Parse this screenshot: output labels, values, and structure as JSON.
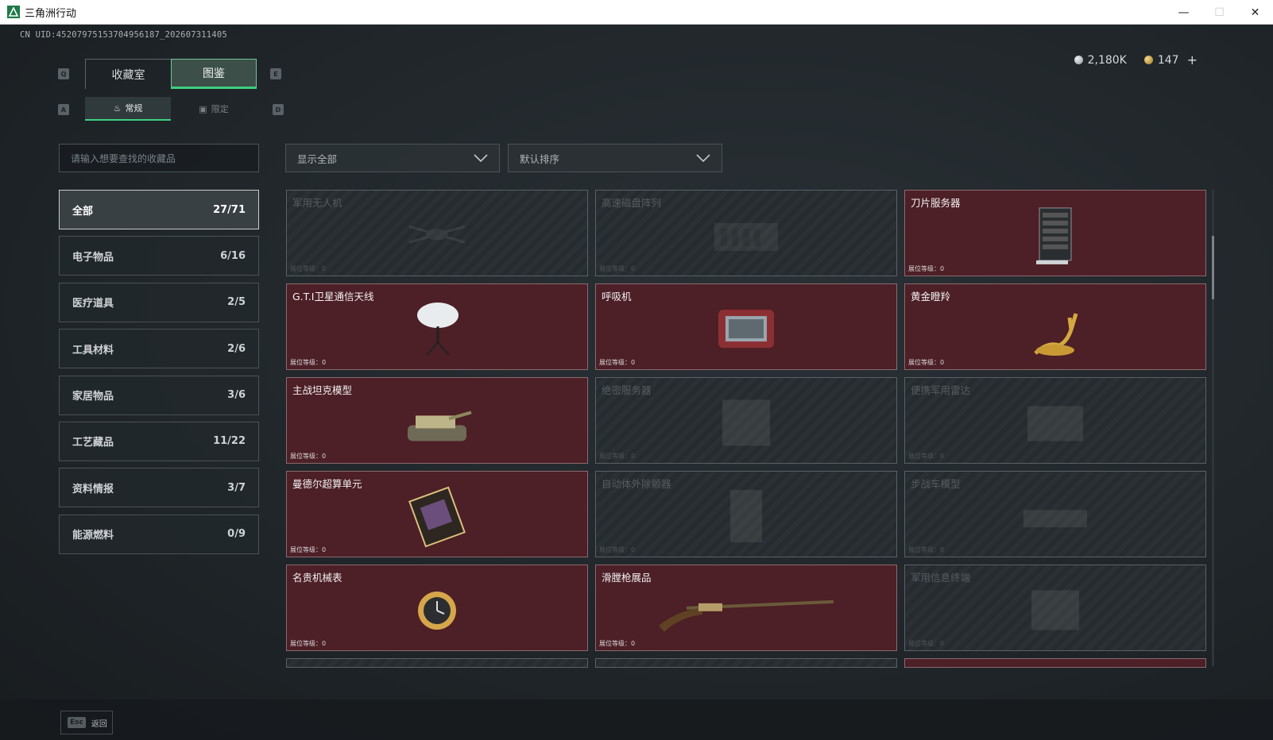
{
  "window": {
    "title": "三角洲行动",
    "minimize": "—",
    "maximize": "☐",
    "close": "✕"
  },
  "uid": "CN UID:4520797515370495​6187_202607311405",
  "currency": {
    "silver": "2,180K",
    "gold": "147",
    "plus": "+"
  },
  "keys": {
    "q": "Q",
    "e": "E",
    "a": "A",
    "d": "D"
  },
  "tabs_top": [
    {
      "label": "收藏室"
    },
    {
      "label": "图鉴"
    }
  ],
  "tabs_sub": [
    {
      "label": "常规",
      "icon": "flame-icon"
    },
    {
      "label": "限定",
      "icon": "image-icon"
    }
  ],
  "search": {
    "placeholder": "请输入想要查找的收藏品"
  },
  "filter": {
    "label": "显示全部"
  },
  "sort": {
    "label": "默认排序"
  },
  "categories": [
    {
      "name": "全部",
      "count": "27/71"
    },
    {
      "name": "电子物品",
      "count": "6/16"
    },
    {
      "name": "医疗道具",
      "count": "2/5"
    },
    {
      "name": "工具材料",
      "count": "2/6"
    },
    {
      "name": "家居物品",
      "count": "3/6"
    },
    {
      "name": "工艺藏品",
      "count": "11/22"
    },
    {
      "name": "资料情报",
      "count": "3/7"
    },
    {
      "name": "能源燃料",
      "count": "0/9"
    }
  ],
  "level_label": "展位等级：",
  "items": [
    {
      "name": "军用无人机",
      "level": "0",
      "owned": false,
      "icon": "drone-icon"
    },
    {
      "name": "高速磁盘阵列",
      "level": "0",
      "owned": false,
      "icon": "disk-array-icon"
    },
    {
      "name": "刀片服务器",
      "level": "0",
      "owned": true,
      "icon": "blade-server-icon"
    },
    {
      "name": "G.T.I卫星通信天线",
      "level": "0",
      "owned": true,
      "icon": "satellite-dish-icon"
    },
    {
      "name": "呼吸机",
      "level": "0",
      "owned": true,
      "icon": "ventilator-icon"
    },
    {
      "name": "黄金瞪羚",
      "level": "0",
      "owned": true,
      "icon": "gold-gazelle-icon"
    },
    {
      "name": "主战坦克模型",
      "level": "0",
      "owned": true,
      "icon": "tank-model-icon"
    },
    {
      "name": "绝密服务器",
      "level": "0",
      "owned": false,
      "icon": "server-icon"
    },
    {
      "name": "便携军用雷达",
      "level": "0",
      "owned": false,
      "icon": "radar-icon"
    },
    {
      "name": "曼德尔超算单元",
      "level": "0",
      "owned": true,
      "icon": "cpu-unit-icon"
    },
    {
      "name": "自动体外除颤器",
      "level": "0",
      "owned": false,
      "icon": "defibrillator-icon"
    },
    {
      "name": "步战车模型",
      "level": "0",
      "owned": false,
      "icon": "ifv-model-icon"
    },
    {
      "name": "名贵机械表",
      "level": "0",
      "owned": true,
      "icon": "watch-icon"
    },
    {
      "name": "滑膛枪展品",
      "level": "0",
      "owned": true,
      "icon": "musket-icon"
    },
    {
      "name": "军用信息终端",
      "level": "0",
      "owned": false,
      "icon": "terminal-icon"
    }
  ],
  "partial_items": [
    {
      "owned": false
    },
    {
      "owned": false
    },
    {
      "owned": true
    }
  ],
  "footer": {
    "esc_key": "Esc",
    "esc_label": "返回"
  }
}
